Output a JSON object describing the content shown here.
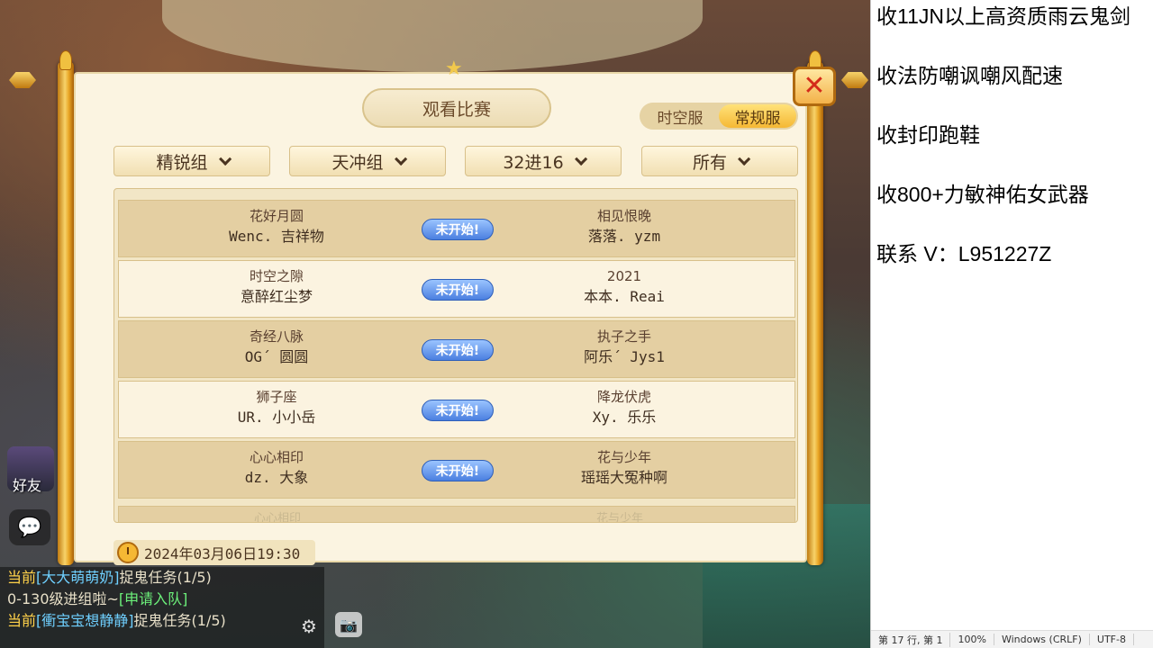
{
  "dialog": {
    "title": "观看比赛",
    "server_toggle": {
      "options": [
        "时空服",
        "常规服"
      ],
      "selected": "常规服"
    },
    "filters": [
      {
        "label": "精锐组"
      },
      {
        "label": "天冲组"
      },
      {
        "label": "32进16"
      },
      {
        "label": "所有"
      }
    ],
    "matches": [
      {
        "left_team": "花好月圆",
        "left_player": "Wenc. 吉祥物",
        "status": "未开始!",
        "right_team": "相见恨晚",
        "right_player": "落落. yzm"
      },
      {
        "left_team": "时空之隙",
        "left_player": "意醉红尘梦",
        "status": "未开始!",
        "right_team": "2021",
        "right_player": "本本. Reai"
      },
      {
        "left_team": "奇经八脉",
        "left_player": "OG´ 圆圆",
        "status": "未开始!",
        "right_team": "执子之手",
        "right_player": "阿乐´ Jys1"
      },
      {
        "left_team": "狮子座",
        "left_player": "UR. 小小岳",
        "status": "未开始!",
        "right_team": "降龙伏虎",
        "right_player": "Xy. 乐乐"
      },
      {
        "left_team": "心心相印",
        "left_player": "dz. 大象",
        "status": "未开始!",
        "right_team": "花与少年",
        "right_player": "瑶瑶大冤种啊"
      }
    ],
    "peek_row": {
      "left": "心心相印",
      "right": "花与少年"
    },
    "datetime": "2024年03月06日19:30"
  },
  "hud": {
    "friends_label": "好友",
    "chat": [
      {
        "channel": "当前",
        "who": "[大大萌萌奶]",
        "msg": "捉鬼任务(1/5)"
      },
      {
        "channel": "",
        "who": "",
        "msg": "0-130级进组啦~",
        "link": "[申请入队]"
      },
      {
        "channel": "当前",
        "who": "[衝宝宝想静静]",
        "msg": "捉鬼任务(1/5)"
      }
    ]
  },
  "notepad": {
    "lines": [
      "收11JN以上高资质雨云鬼剑",
      "收法防嘲讽嘲风配速",
      "收封印跑鞋",
      "收800+力敏神佑女武器",
      "联系 V：L951227Z"
    ],
    "status": {
      "position": "第 17 行, 第 1",
      "zoom": "100%",
      "eol": "Windows (CRLF)",
      "encoding": "UTF-8"
    }
  }
}
